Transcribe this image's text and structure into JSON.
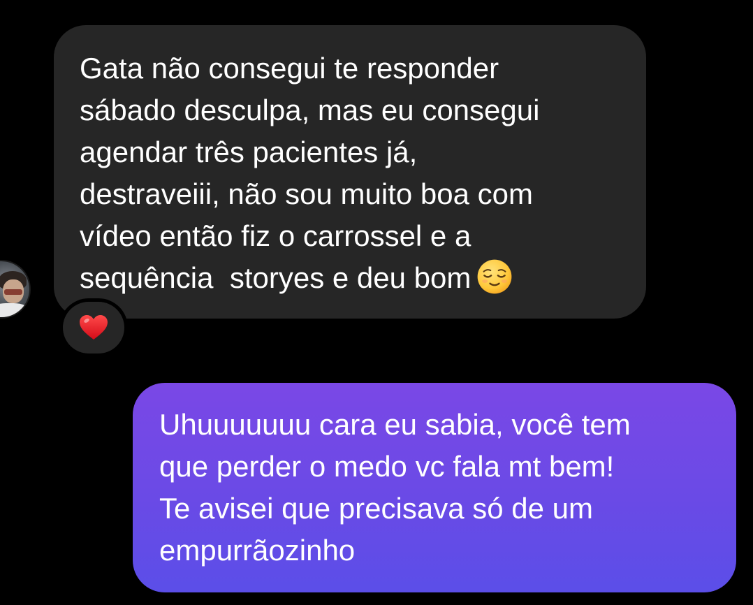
{
  "conversation": {
    "received": {
      "lines": [
        "Gata não consegui te responder",
        "sábado desculpa, mas eu consegui",
        "agendar três pacientes já,",
        "destraveiii, não sou muito boa com",
        "vídeo então fiz o carrossel e a",
        "sequência  storyes e deu bom"
      ],
      "trailing_emoji": "relieved-face",
      "reaction": "red-heart",
      "bubble_color": "#262626"
    },
    "sent": {
      "lines": [
        "Uhuuuuuuu cara eu sabia, você tem",
        "que perder o medo vc fala mt bem!",
        "Te avisei que precisava só de um",
        "empurrãozinho"
      ],
      "bubble_gradient": [
        "#7a48e6",
        "#5b4ee8"
      ]
    }
  },
  "background_color": "#000000",
  "text_color": "#ffffff"
}
